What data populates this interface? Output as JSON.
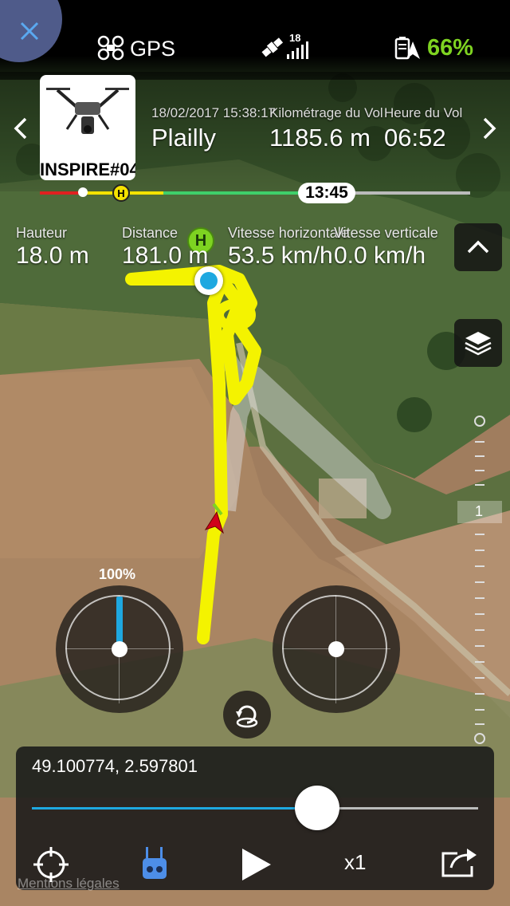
{
  "status_bar": {
    "gps_label": "GPS",
    "satellite_count": "18",
    "battery_percent": "66%",
    "battery_color": "#7ed321"
  },
  "flight": {
    "drone_name": "INSPIRE#04",
    "date_time": "18/02/2017 15:38:17",
    "location": "Plailly",
    "distance_label": "Kilométrage du Vol",
    "distance_value": "1185.6 m",
    "time_label": "Heure du Vol",
    "time_value": "06:52"
  },
  "timeline": {
    "time_badge": "13:45",
    "home_marker": "H"
  },
  "telemetry": {
    "height_label": "Hauteur",
    "height_value": "18.0 m",
    "distance_label": "Distance",
    "distance_value": "181.0 m",
    "hspeed_label": "Vitesse horizontale",
    "hspeed_value": "53.5 km/h",
    "vspeed_label": "Vitesse verticale",
    "vspeed_value": "0.0 km/h"
  },
  "map": {
    "home_marker": "H",
    "altitude_scale_marker": "1"
  },
  "sticks": {
    "left_percent_label": "100%",
    "throttle_percent": 100
  },
  "playback": {
    "coordinates": "49.100774, 2.597801",
    "progress_percent": 64,
    "speed_label": "x1",
    "accent_color": "#1ea8e0"
  },
  "footer": {
    "legal_link": "Mentions légales"
  }
}
